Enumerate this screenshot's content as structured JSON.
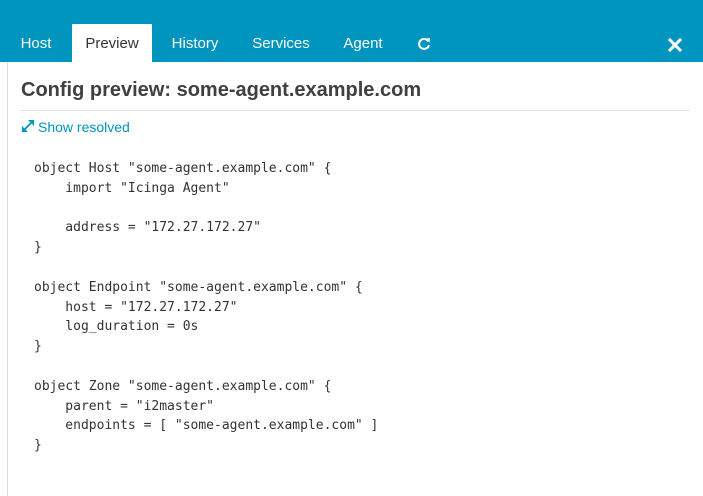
{
  "tabs": [
    {
      "label": "Host",
      "active": false
    },
    {
      "label": "Preview",
      "active": true
    },
    {
      "label": "History",
      "active": false
    },
    {
      "label": "Services",
      "active": false
    },
    {
      "label": "Agent",
      "active": false
    }
  ],
  "icons": {
    "refresh": "refresh-icon",
    "close": "close-icon",
    "expand": "expand-arrows-icon"
  },
  "colors": {
    "accent": "#0095bf",
    "text": "#333333"
  },
  "title": "Config preview: some-agent.example.com",
  "show_resolved_label": "Show resolved",
  "config_code": "object Host \"some-agent.example.com\" {\n    import \"Icinga Agent\"\n\n    address = \"172.27.172.27\"\n}\n\nobject Endpoint \"some-agent.example.com\" {\n    host = \"172.27.172.27\"\n    log_duration = 0s\n}\n\nobject Zone \"some-agent.example.com\" {\n    parent = \"i2master\"\n    endpoints = [ \"some-agent.example.com\" ]\n}"
}
